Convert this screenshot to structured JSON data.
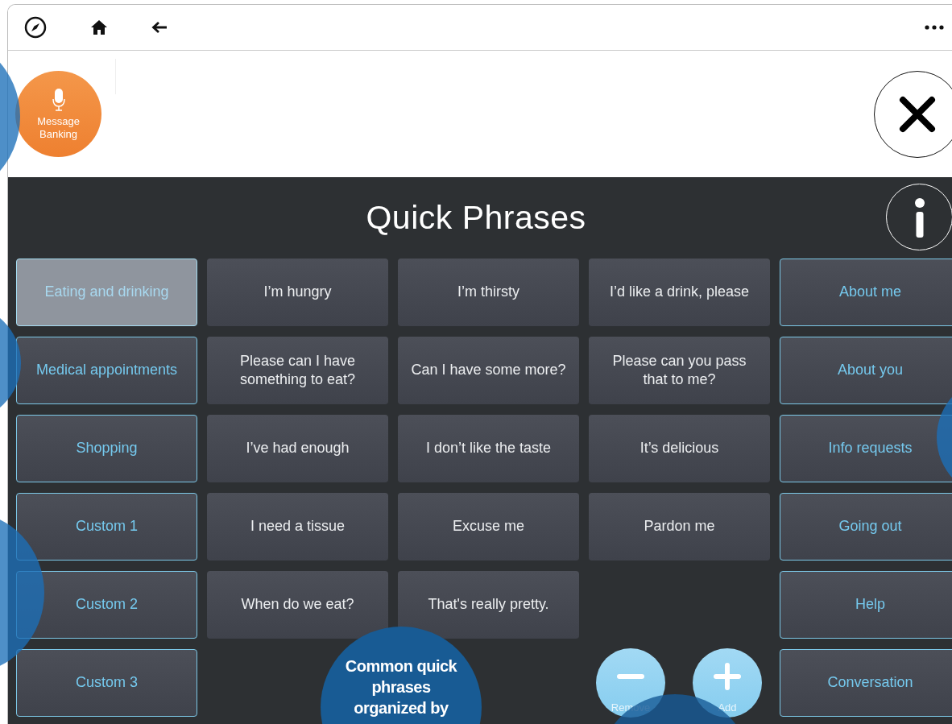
{
  "message_banking": {
    "label": "Message Banking"
  },
  "title": "Quick Phrases",
  "categories_left": [
    {
      "label": "Eating and drinking",
      "selected": true
    },
    {
      "label": "Medical appointments",
      "selected": false
    },
    {
      "label": "Shopping",
      "selected": false
    },
    {
      "label": "Custom 1",
      "selected": false
    },
    {
      "label": "Custom 2",
      "selected": false
    },
    {
      "label": "Custom 3",
      "selected": false
    }
  ],
  "phrase_rows": [
    [
      "I’m hungry",
      "I’m thirsty",
      "I’d like a drink, please"
    ],
    [
      "Please can I have something to eat?",
      "Can I have some more?",
      "Please can you pass that to me?"
    ],
    [
      "I’ve had enough",
      "I don’t like the taste",
      "It’s delicious"
    ],
    [
      "I need a tissue",
      "Excuse me",
      "Pardon me"
    ],
    [
      "When do we eat?",
      "That's really pretty."
    ]
  ],
  "actions": [
    {
      "label": "Remove",
      "kind": "remove"
    },
    {
      "label": "Add",
      "kind": "add"
    }
  ],
  "categories_right": [
    {
      "label": "About me",
      "selected": false
    },
    {
      "label": "About you",
      "selected": false
    },
    {
      "label": "Info requests",
      "selected": false
    },
    {
      "label": "Going out",
      "selected": false
    },
    {
      "label": "Help",
      "selected": false
    },
    {
      "label": "Conversation",
      "selected": false
    }
  ],
  "annotation": {
    "text": "Common quick phrases organized by"
  }
}
